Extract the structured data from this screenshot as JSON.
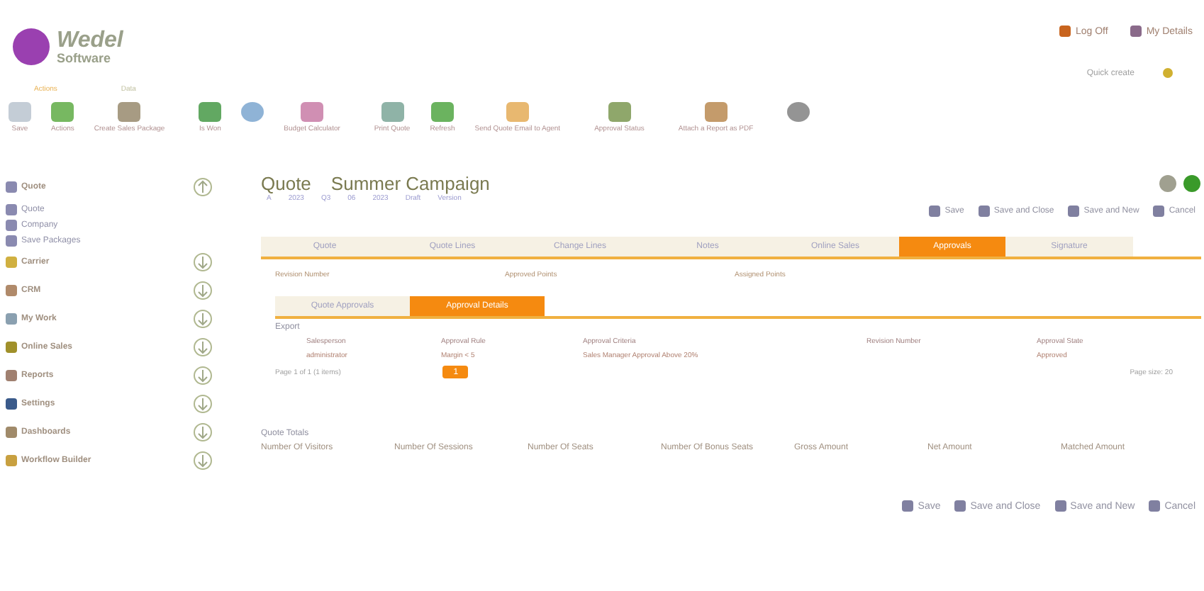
{
  "logo": {
    "name": "Wedel",
    "tagline": "Software"
  },
  "header_links": [
    {
      "label": "Log Off"
    },
    {
      "label": "My Details"
    }
  ],
  "quick_create": {
    "label": "Quick create"
  },
  "ribbon": {
    "groups": [
      "Actions",
      "Data"
    ],
    "buttons": [
      {
        "label": "Save"
      },
      {
        "label": "Actions"
      },
      {
        "label": "Create Sales Package"
      },
      {
        "label": "Is Won"
      },
      {
        "kind": "icon_only"
      },
      {
        "label": "Budget Calculator"
      },
      {
        "label": "Print Quote"
      },
      {
        "label": "Refresh"
      },
      {
        "label": "Send Quote Email to Agent"
      },
      {
        "label": "Approval Status"
      },
      {
        "label": "Attach a Report as PDF"
      },
      {
        "kind": "icon_only"
      }
    ]
  },
  "sidebar": {
    "items": [
      {
        "label": "Quote",
        "expanded": true,
        "children": [
          {
            "label": "Quote"
          },
          {
            "label": "Company"
          },
          {
            "label": "Save Packages"
          }
        ]
      },
      {
        "label": "Carrier",
        "expanded": false
      },
      {
        "label": "CRM",
        "expanded": false
      },
      {
        "label": "My Work",
        "expanded": false
      },
      {
        "label": "Online Sales",
        "expanded": false
      },
      {
        "label": "Reports",
        "expanded": false
      },
      {
        "label": "Settings",
        "expanded": false
      },
      {
        "label": "Dashboards",
        "expanded": false
      },
      {
        "label": "Workflow Builder",
        "expanded": false
      }
    ]
  },
  "record": {
    "type": "Quote",
    "name": "Summer Campaign",
    "meta": [
      "A",
      "2023",
      "Q3",
      "06",
      "2023",
      "Draft",
      "Version"
    ]
  },
  "actions_top": [
    "Save",
    "Save and Close",
    "Save and New",
    "Cancel"
  ],
  "tabs": [
    {
      "label": "Quote",
      "selected": false
    },
    {
      "label": "Quote Lines",
      "selected": false
    },
    {
      "label": "Change Lines",
      "selected": false
    },
    {
      "label": "Notes",
      "selected": false
    },
    {
      "label": "Online Sales",
      "selected": false
    },
    {
      "label": "Approvals",
      "selected": true
    },
    {
      "label": "Signature",
      "selected": false
    }
  ],
  "fields": [
    {
      "label": "Revision Number"
    },
    {
      "label": "Approved Points"
    },
    {
      "label": "Assigned Points"
    }
  ],
  "subtabs": [
    {
      "label": "Quote Approvals",
      "selected": false
    },
    {
      "label": "Approval Details",
      "selected": true
    }
  ],
  "grid": {
    "export": "Export",
    "columns": [
      "Salesperson",
      "Approval Rule",
      "Approval Criteria",
      "Revision Number",
      "Approval State"
    ],
    "rows": [
      [
        "administrator",
        "Margin < 5",
        "Sales Manager Approval Above 20%",
        "",
        "Approved"
      ]
    ],
    "pager": {
      "summary": "Page 1 of 1 (1 items)",
      "page": "1",
      "size": "Page size: 20"
    }
  },
  "totals": {
    "title": "Quote Totals",
    "columns": [
      "Number Of Visitors",
      "Number Of Sessions",
      "Number Of Seats",
      "Number Of Bonus Seats",
      "Gross Amount",
      "Net Amount",
      "Matched Amount"
    ]
  },
  "actions_bottom": [
    "Save",
    "Save and Close",
    "Save and New",
    "Cancel"
  ]
}
